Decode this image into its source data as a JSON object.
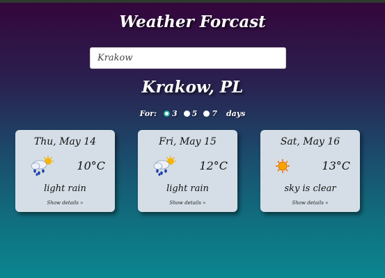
{
  "app": {
    "title": "Weather Forcast"
  },
  "search": {
    "value": "Krakow"
  },
  "location": {
    "name": "Krakow, PL"
  },
  "forecast_days": {
    "label": "For:",
    "options": [
      "3",
      "5",
      "7"
    ],
    "selected": "3",
    "suffix": "days"
  },
  "cards": [
    {
      "date": "Thu, May 14",
      "icon": "light-rain-icon",
      "temp": "10°C",
      "desc": "light rain",
      "details": "Show details »"
    },
    {
      "date": "Fri, May 15",
      "icon": "light-rain-icon",
      "temp": "12°C",
      "desc": "light rain",
      "details": "Show details »"
    },
    {
      "date": "Sat, May 16",
      "icon": "sun-icon",
      "temp": "13°C",
      "desc": "sky is clear",
      "details": "Show details »"
    }
  ],
  "colors": {
    "radio_accent": "#26b29a",
    "card_bg": "#d5dee6"
  }
}
